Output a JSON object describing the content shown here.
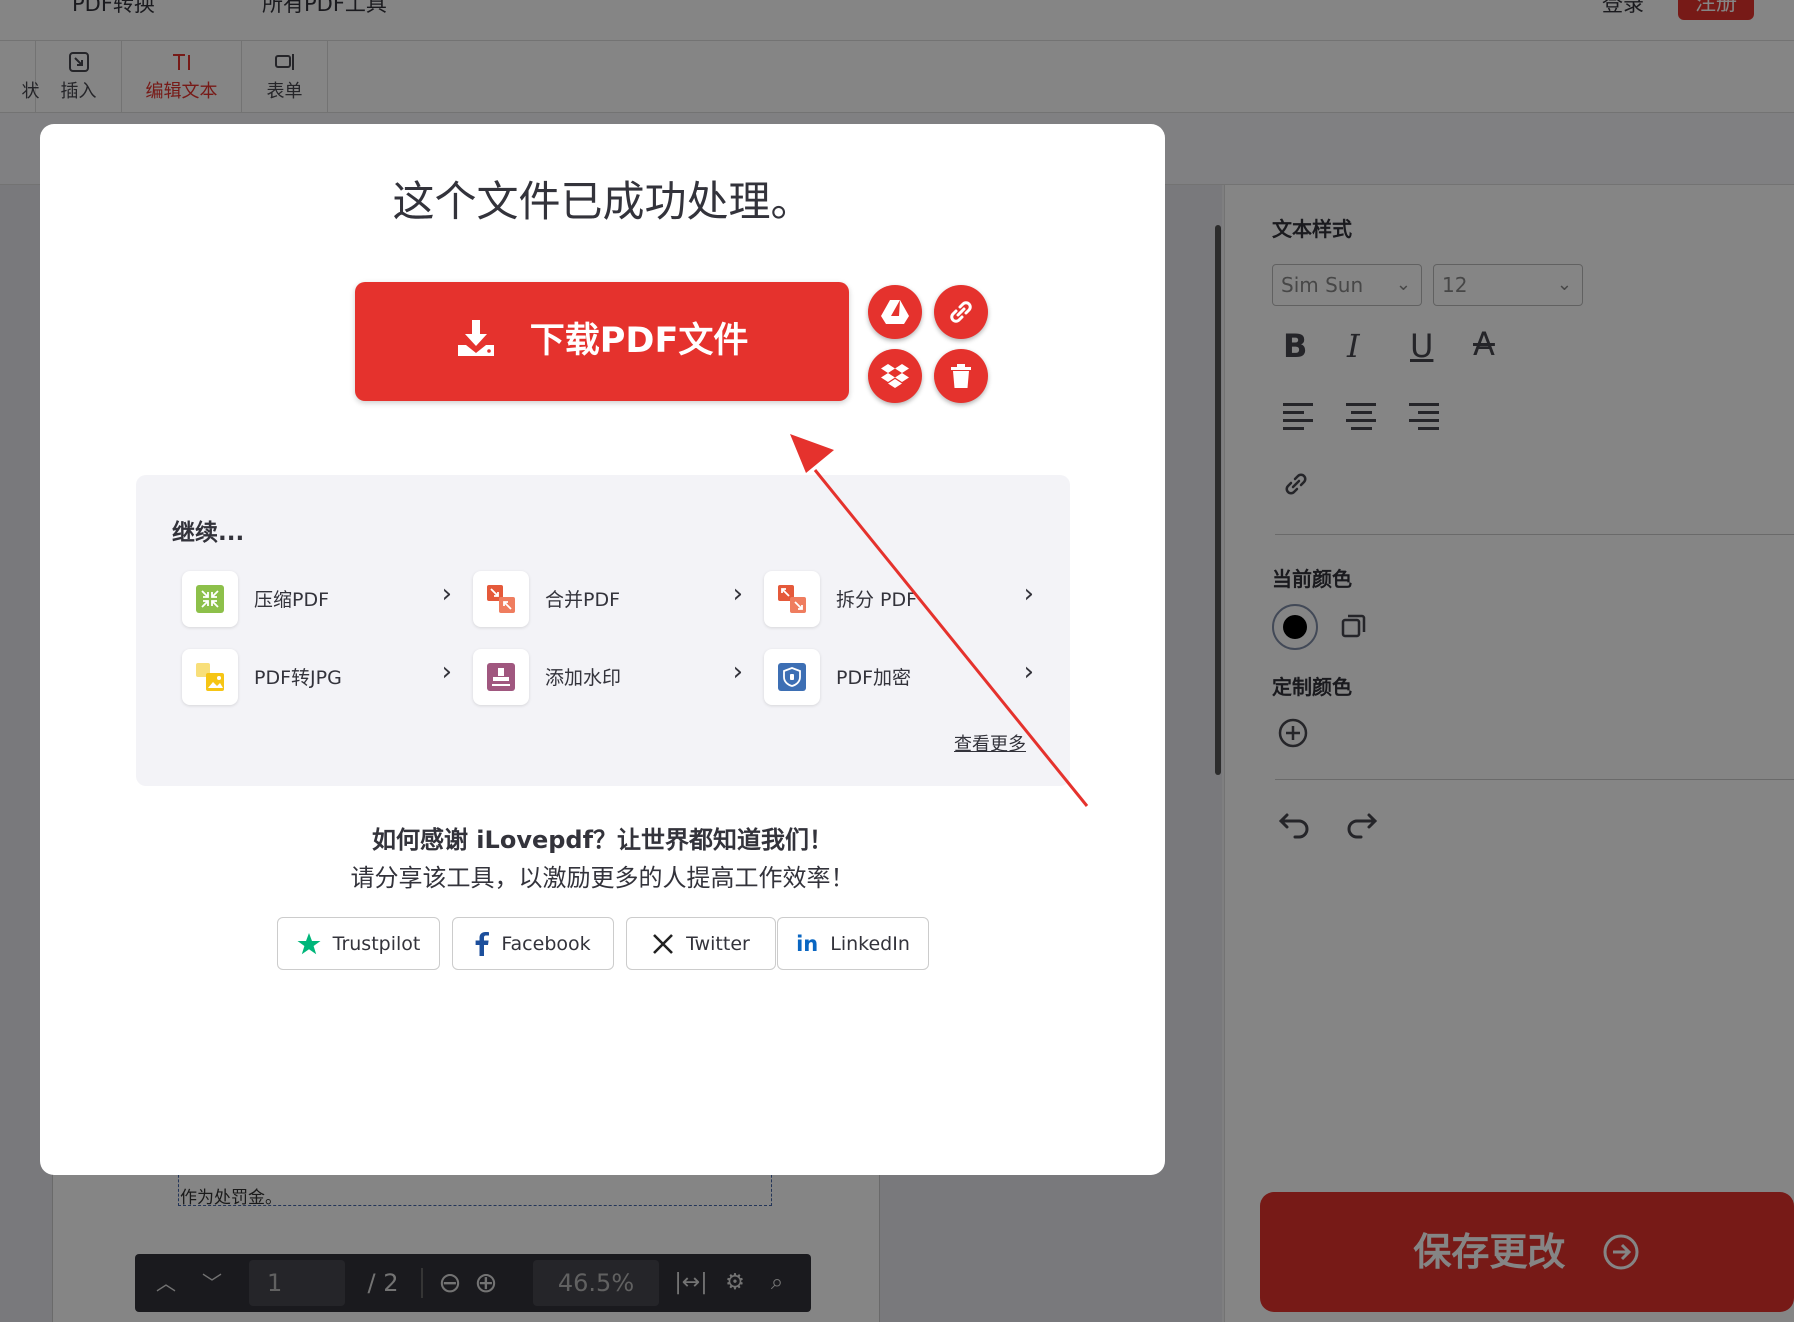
{
  "topnav": {
    "link1": "PDF转换",
    "link2": "所有PDF工具",
    "login": "登录",
    "signup": "注册"
  },
  "toolbar": {
    "partial_tool": "状",
    "insert": "插入",
    "edit_text": "编辑文本",
    "form": "表单"
  },
  "document": {
    "text": "作为处罚金。"
  },
  "pager": {
    "page": "1",
    "total": "/ 2",
    "zoom": "46.5%"
  },
  "sidebar": {
    "text_style_title": "文本样式",
    "font": "Sim Sun",
    "size": "12",
    "bold": "B",
    "italic": "I",
    "underline": "U",
    "strike": "A",
    "current_color_title": "当前颜色",
    "custom_color_title": "定制颜色",
    "save_label": "保存更改"
  },
  "modal": {
    "title": "这个文件已成功处理。",
    "download_label": "下载PDF文件",
    "continue_title": "继续...",
    "tools": [
      {
        "label": "压缩PDF",
        "icon": "compress-icon",
        "color": "#8dc04a"
      },
      {
        "label": "合并PDF",
        "icon": "merge-icon",
        "color": "#e5593a"
      },
      {
        "label": "拆分 PDF",
        "icon": "split-icon",
        "color": "#e5593a"
      },
      {
        "label": "PDF转JPG",
        "icon": "pdf-to-jpg-icon",
        "color": "#f6c515"
      },
      {
        "label": "添加水印",
        "icon": "watermark-icon",
        "color": "#a0577f"
      },
      {
        "label": "PDF加密",
        "icon": "protect-icon",
        "color": "#3d6fb4"
      }
    ],
    "see_more": "查看更多",
    "thanks": "如何感谢 iLovepdf？让世界都知道我们！",
    "share_sub": "请分享该工具，以激励更多的人提高工作效率！",
    "social": {
      "trustpilot": "Trustpilot",
      "facebook": "Facebook",
      "twitter": "Twitter",
      "linkedin": "LinkedIn"
    }
  },
  "colors": {
    "brand_red": "#e5322d",
    "trustpilot_green": "#00b67a",
    "facebook_blue": "#1877f2",
    "linkedin_blue": "#0a66c2"
  }
}
